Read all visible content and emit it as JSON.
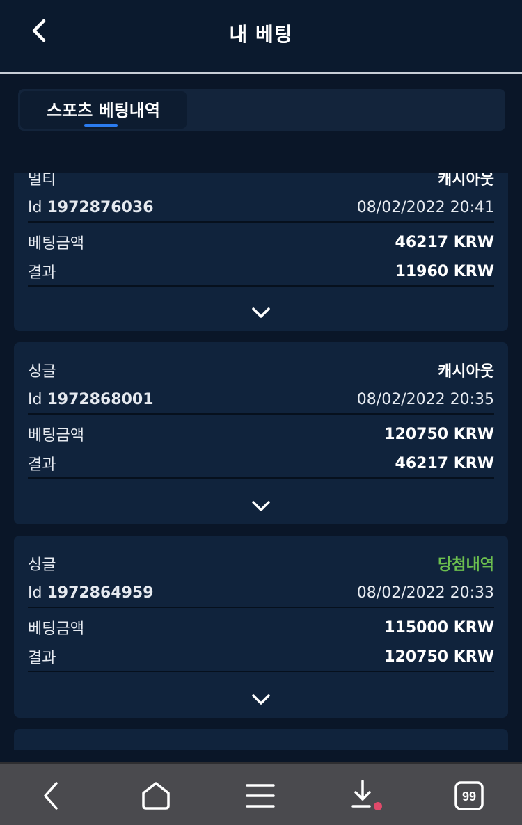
{
  "header": {
    "title": "내 베팅",
    "back_icon": "chevron-left-icon"
  },
  "tabs": [
    {
      "label": "스포츠 베팅내역",
      "active": true
    }
  ],
  "bets": [
    {
      "type": "멀티",
      "status": "캐시아웃",
      "status_color": "#ffffff",
      "id_label": "Id",
      "id": "1972876036",
      "datetime": "08/02/2022 20:41",
      "amount_label": "베팅금액",
      "amount": "46217 KRW",
      "result_label": "결과",
      "result": "11960 KRW"
    },
    {
      "type": "싱글",
      "status": "캐시아웃",
      "status_color": "#ffffff",
      "id_label": "Id",
      "id": "1972868001",
      "datetime": "08/02/2022 20:35",
      "amount_label": "베팅금액",
      "amount": "120750 KRW",
      "result_label": "결과",
      "result": "46217 KRW"
    },
    {
      "type": "싱글",
      "status": "당첨내역",
      "status_color": "#6cbf4f",
      "id_label": "Id",
      "id": "1972864959",
      "datetime": "08/02/2022 20:33",
      "amount_label": "베팅금액",
      "amount": "115000 KRW",
      "result_label": "결과",
      "result": "120750 KRW"
    }
  ],
  "bottom_nav": {
    "items": [
      "back-icon",
      "home-icon",
      "menu-icon",
      "download-icon",
      "tabs-icon"
    ],
    "tabs_count": "99",
    "download_badge_color": "#e04a6a"
  }
}
